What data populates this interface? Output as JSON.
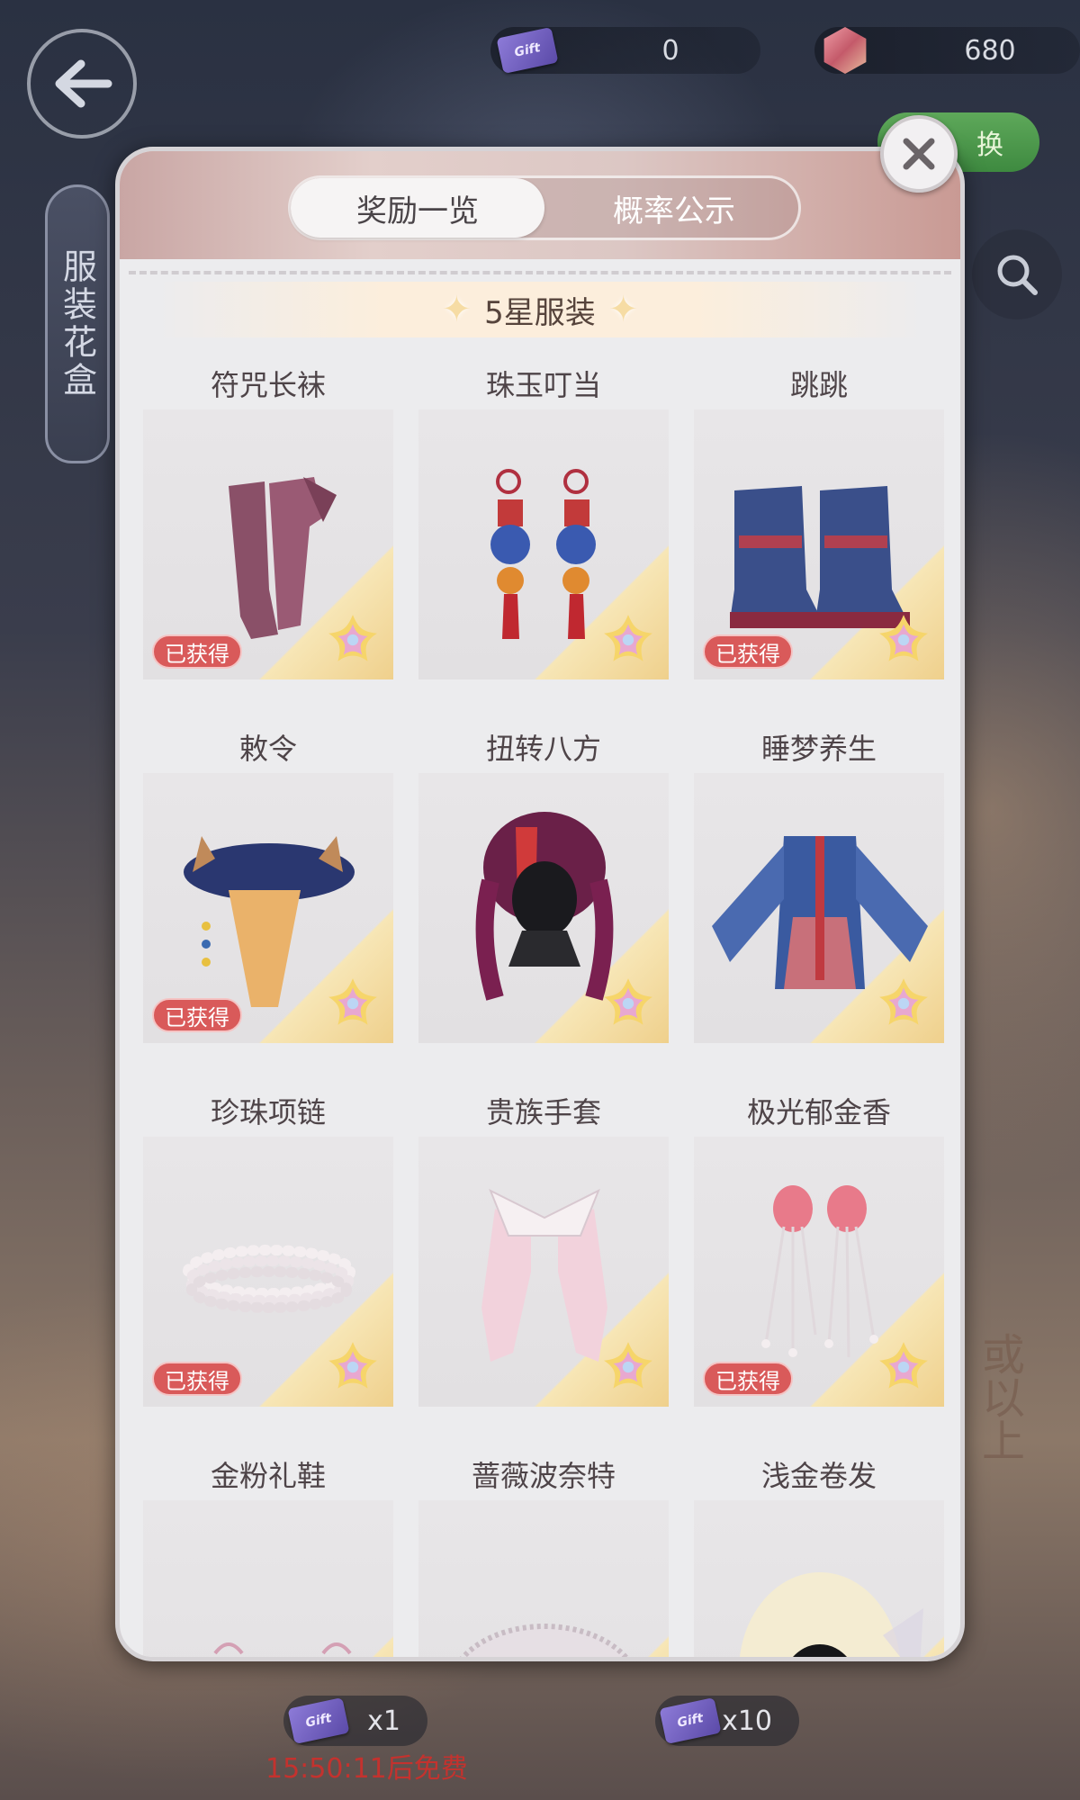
{
  "currency": {
    "tickets": {
      "icon": "gift-ticket-icon",
      "icon_text": "Gift",
      "value": "0"
    },
    "gems": {
      "icon": "gem-icon",
      "value": "680"
    }
  },
  "exchange_label": "换",
  "side_tab_label": "服装花盒",
  "background_text": "或以上",
  "modal": {
    "tabs": [
      {
        "label": "奖励一览",
        "active": true
      },
      {
        "label": "概率公示",
        "active": false
      }
    ],
    "section_title": "5星服装",
    "owned_label": "已获得",
    "items": [
      {
        "name": "符咒长袜",
        "owned": true,
        "art": "stockings"
      },
      {
        "name": "珠玉叮当",
        "owned": false,
        "art": "earrings"
      },
      {
        "name": "跳跳",
        "owned": true,
        "art": "boots"
      },
      {
        "name": "敕令",
        "owned": true,
        "art": "hat"
      },
      {
        "name": "扭转八方",
        "owned": false,
        "art": "hair-braids"
      },
      {
        "name": "睡梦养生",
        "owned": false,
        "art": "jacket"
      },
      {
        "name": "珍珠项链",
        "owned": true,
        "art": "pearl-necklace"
      },
      {
        "name": "贵族手套",
        "owned": false,
        "art": "gloves"
      },
      {
        "name": "极光郁金香",
        "owned": true,
        "art": "tulip-hairpins"
      },
      {
        "name": "金粉礼鞋",
        "owned": false,
        "art": "shoes"
      },
      {
        "name": "蔷薇波奈特",
        "owned": false,
        "art": "bonnet"
      },
      {
        "name": "浅金卷发",
        "owned": false,
        "art": "blonde-curls"
      }
    ]
  },
  "draw": {
    "single": {
      "icon_text": "Gift",
      "label": "x1"
    },
    "ten": {
      "icon_text": "Gift",
      "label": "x10"
    },
    "timer": "15:50:11后免费"
  },
  "colors": {
    "owned_badge": "#d95a5a",
    "exchange_button": "#4a9a48",
    "timer": "#c4322e"
  }
}
